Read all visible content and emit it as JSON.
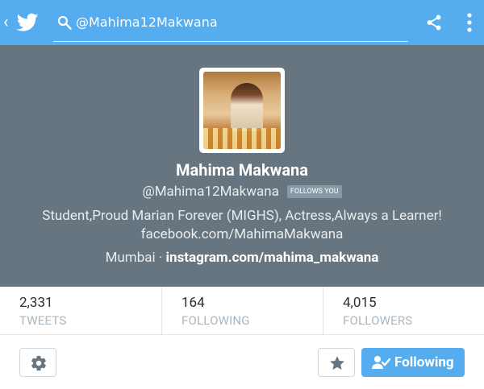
{
  "topbar": {
    "back_icon": "chevron-left-icon",
    "logo_icon": "twitter-bird-icon",
    "search_value": "@Mahima12Makwana",
    "search_icon": "search-icon",
    "share_icon": "share-icon",
    "more_icon": "more-vertical-icon"
  },
  "profile": {
    "name": "Mahima Makwana",
    "handle": "@Mahima12Makwana",
    "follows_you_badge": "FOLLOWS YOU",
    "bio_line1": "Student,Proud Marian Forever (MIGHS), Actress,Always a Learner!",
    "bio_line2": "facebook.com/MahimaMakwana",
    "location": "Mumbai",
    "separator": "·",
    "website": "instagram.com/mahima_makwana"
  },
  "stats": [
    {
      "value": "2,331",
      "label": "TWEETS"
    },
    {
      "value": "164",
      "label": "FOLLOWING"
    },
    {
      "value": "4,015",
      "label": "FOLLOWERS"
    }
  ],
  "actions": {
    "settings_icon": "gear-icon",
    "star_icon": "star-icon",
    "following_label": "Following",
    "following_icon": "user-check-icon"
  },
  "colors": {
    "accent": "#55acee",
    "header_bg": "#66757f",
    "badge_bg": "#8899a6",
    "stat_label": "#a9b7c2"
  }
}
